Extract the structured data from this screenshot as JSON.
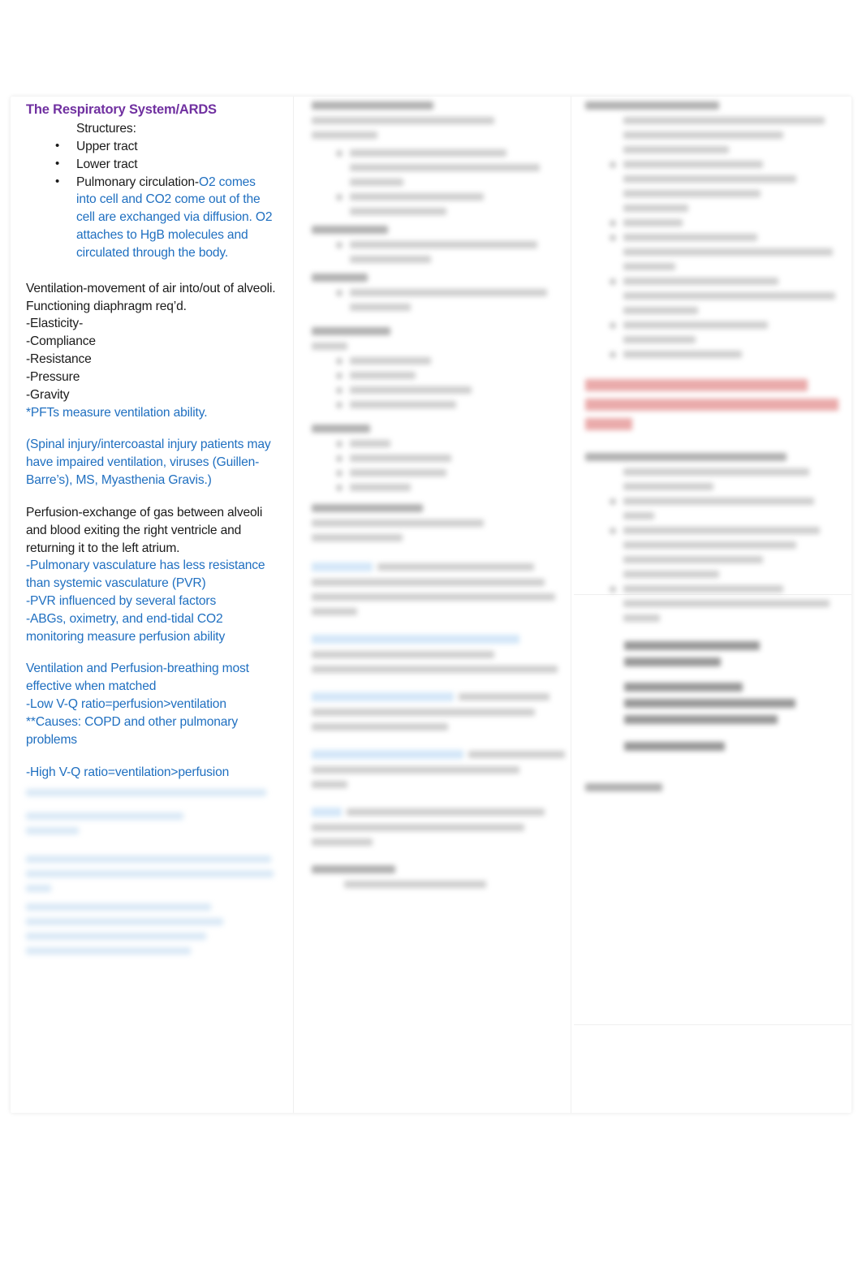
{
  "document": {
    "title": "The Respiratory System/ARDS",
    "page_background": "#ffffff",
    "heading_color": "#7030A0",
    "body_color": "#1a1a1a",
    "accent_blue": "#1F6FC0",
    "accent_red": "#e05a5a"
  },
  "column_1": {
    "title": "The Respiratory System/ARDS",
    "structures_label": "Structures:",
    "bullets": [
      {
        "text": "Upper tract",
        "blue_run": ""
      },
      {
        "text": "Lower tract",
        "blue_run": ""
      },
      {
        "text": "Pulmonary circulation-",
        "blue_run": "O2 comes into cell and CO2 come out of the cell are exchanged via diffusion. O2 attaches to HgB molecules and circulated through the body."
      }
    ],
    "ventilation_def": "Ventilation-movement of air into/out of alveoli. Functioning diaphragm req’d.",
    "ventilation_factors": [
      "-Elasticity-",
      "-Compliance",
      "-Resistance",
      "-Pressure",
      "-Gravity"
    ],
    "pfts_note": "*PFTs measure ventilation ability.",
    "impaired_note": "(Spinal injury/intercoastal injury patients may have impaired ventilation, viruses (Guillen-Barre’s), MS, Myasthenia Gravis.)",
    "perfusion_def": "Perfusion-exchange of gas between alveoli and blood exiting the right ventricle and returning it to the left atrium.",
    "perfusion_points": [
      "-Pulmonary vasculature has less resistance than systemic vasculature (PVR)",
      "-PVR influenced by several factors",
      "-ABGs, oximetry, and end-tidal CO2 monitoring measure perfusion ability"
    ],
    "vq_heading": "Ventilation and Perfusion-breathing most effective when matched",
    "vq_low": "-Low V-Q ratio=perfusion>ventilation",
    "vq_low_causes": "**Causes: COPD and other pulmonary problems",
    "vq_high": "-High V-Q ratio=ventilation>perfusion",
    "redacted_note": "remaining text in this column is blurred / illegible"
  },
  "column_2": {
    "redacted_note": "entire column is blurred / illegible"
  },
  "column_3": {
    "redacted_note": "entire column is blurred / illegible; includes a red-highlighted warning block and bold black sub-headings"
  }
}
